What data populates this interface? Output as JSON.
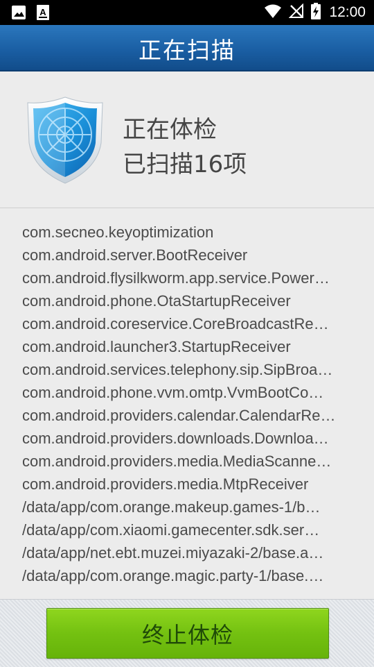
{
  "status_bar": {
    "time": "12:00",
    "left_icons": [
      "image-icon",
      "font-icon"
    ],
    "right_icons": [
      "wifi-icon",
      "no-signal-icon",
      "battery-charging-icon"
    ]
  },
  "header": {
    "title": "正在扫描"
  },
  "scan_status": {
    "line1": "正在体检",
    "line2": "已扫描16项"
  },
  "scan_items": [
    "com.secneo.keyoptimization",
    "com.android.server.BootReceiver",
    "com.android.flysilkworm.app.service.Power…",
    "com.android.phone.OtaStartupReceiver",
    "com.android.coreservice.CoreBroadcastRe…",
    "com.android.launcher3.StartupReceiver",
    "com.android.services.telephony.sip.SipBroa…",
    "com.android.phone.vvm.omtp.VvmBootCo…",
    "com.android.providers.calendar.CalendarRe…",
    "com.android.providers.downloads.Downloa…",
    "com.android.providers.media.MediaScanne…",
    "com.android.providers.media.MtpReceiver",
    "/data/app/com.orange.makeup.games-1/b…",
    "/data/app/com.xiaomi.gamecenter.sdk.ser…",
    "/data/app/net.ebt.muzei.miyazaki-2/base.a…",
    "/data/app/com.orange.magic.party-1/base.…"
  ],
  "footer": {
    "stop_label": "终止体检"
  },
  "colors": {
    "header_blue": "#1a5ea3",
    "button_green": "#74c111",
    "button_text": "#1f4a08"
  }
}
